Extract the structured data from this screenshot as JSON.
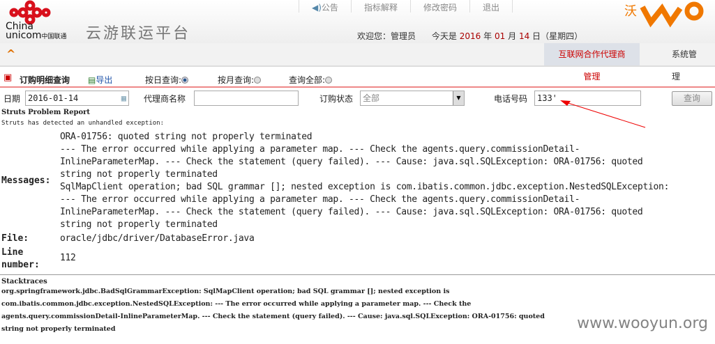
{
  "header": {
    "brand_logo_text": "China unicom中国联通",
    "platform_title": "云游联运平台",
    "top_links": [
      "公告",
      "指标解释",
      "修改密码",
      "退出"
    ],
    "welcome_label": "欢迎您：",
    "user": "管理员",
    "today_label": "今天是",
    "year": "2016",
    "year_unit": "年",
    "month": "01",
    "month_unit": "月",
    "day": "14",
    "day_unit": "日",
    "weekday": "（星期四）",
    "wo_logo": "沃"
  },
  "nav": {
    "tabs": [
      "互联网合作代理商管理",
      "系统管理"
    ]
  },
  "toolbar": {
    "title": "订购明细查询",
    "export": "导出",
    "by_day": "按日查询:",
    "by_month": "按月查询:",
    "all": "查询全部:"
  },
  "filters": {
    "date_label": "日期",
    "date_value": "2016-01-14",
    "agent_label": "代理商名称",
    "agent_value": "",
    "status_label": "订购状态",
    "status_value": "全部",
    "phone_label": "电话号码",
    "phone_value": "133'",
    "query_button": "查询"
  },
  "error": {
    "title": "Struts Problem Report",
    "subtitle": "Struts has detected an unhandled exception:",
    "messages_label": "Messages:",
    "messages": [
      "ORA-01756: quoted string not properly terminated",
      "--- The error occurred while applying a parameter map. --- Check the agents.query.commissionDetail-",
      "InlineParameterMap. --- Check the statement (query failed). --- Cause: java.sql.SQLException: ORA-01756: quoted",
      "string not properly terminated",
      "SqlMapClient operation; bad SQL grammar []; nested exception is com.ibatis.common.jdbc.exception.NestedSQLException:",
      "--- The error occurred while applying a parameter map. --- Check the agents.query.commissionDetail-",
      "InlineParameterMap. --- Check the statement (query failed). --- Cause: java.sql.SQLException: ORA-01756: quoted",
      "string not properly terminated"
    ],
    "file_label": "File:",
    "file": "oracle/jdbc/driver/DatabaseError.java",
    "line_label_1": "Line",
    "line_label_2": "number:",
    "line": "112",
    "stacktraces_label": "Stacktraces",
    "stacktrace": [
      "org.springframework.jdbc.BadSqlGrammarException: SqlMapClient operation; bad SQL grammar []; nested exception is",
      "com.ibatis.common.jdbc.exception.NestedSQLException: --- The error occurred while applying a parameter map. --- Check the",
      "agents.query.commissionDetail-InlineParameterMap. --- Check the statement (query failed). --- Cause: java.sql.SQLException: ORA-01756: quoted",
      "string not properly terminated"
    ]
  },
  "watermark": "www.wooyun.org"
}
